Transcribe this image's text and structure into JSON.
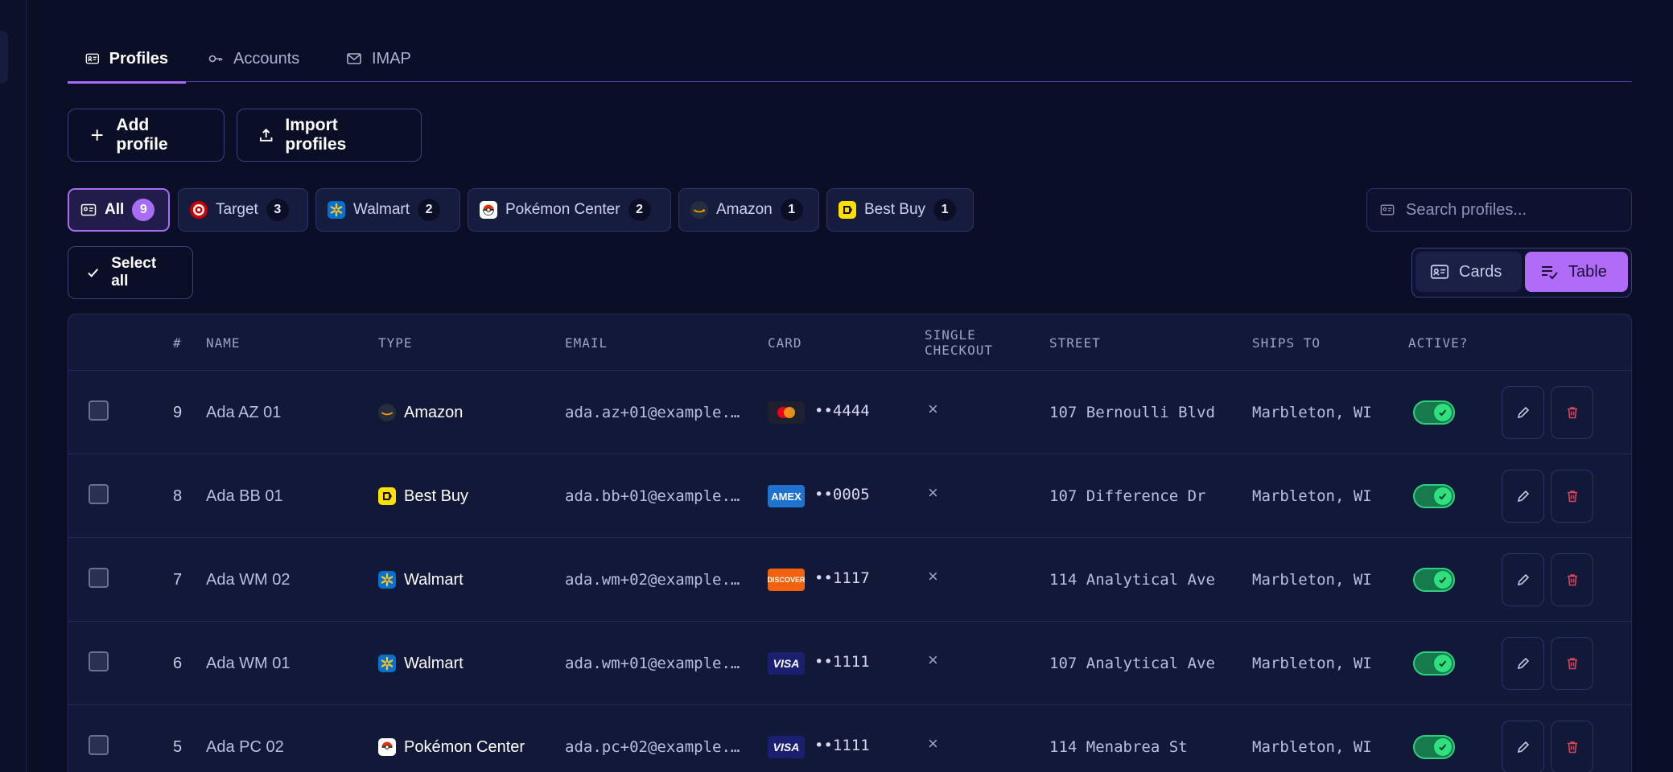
{
  "tabs": [
    {
      "label": "Profiles",
      "icon": "id-card-icon",
      "active": true
    },
    {
      "label": "Accounts",
      "icon": "key-icon",
      "active": false
    },
    {
      "label": "IMAP",
      "icon": "mail-icon",
      "active": false
    }
  ],
  "actions": {
    "add_label": "Add profile",
    "import_label": "Import profiles"
  },
  "filters": [
    {
      "label": "All",
      "count": "9",
      "icon": "id-card-icon"
    },
    {
      "label": "Target",
      "count": "3",
      "icon": "target-logo"
    },
    {
      "label": "Walmart",
      "count": "2",
      "icon": "walmart-logo"
    },
    {
      "label": "Pokémon Center",
      "count": "2",
      "icon": "pokeball-logo"
    },
    {
      "label": "Amazon",
      "count": "1",
      "icon": "amazon-logo"
    },
    {
      "label": "Best Buy",
      "count": "1",
      "icon": "bestbuy-logo"
    }
  ],
  "search": {
    "placeholder": "Search profiles..."
  },
  "select_all_label": "Select all",
  "view": {
    "cards_label": "Cards",
    "table_label": "Table",
    "selected": "Table"
  },
  "table": {
    "headers": {
      "num": "#",
      "name": "NAME",
      "type": "TYPE",
      "email": "EMAIL",
      "card": "CARD",
      "single1": "SINGLE",
      "single2": "CHECKOUT",
      "street": "STREET",
      "ships": "SHIPS TO",
      "active": "ACTIVE?"
    },
    "rows": [
      {
        "num": "9",
        "name": "Ada AZ 01",
        "type": "Amazon",
        "email": "ada.az+01@example.…",
        "card_brand": "mastercard",
        "card_last": "••4444",
        "single_checkout": "×",
        "street": "107 Bernoulli Blvd",
        "ships_to": "Marbleton, WI",
        "active": true
      },
      {
        "num": "8",
        "name": "Ada BB 01",
        "type": "Best Buy",
        "email": "ada.bb+01@example.…",
        "card_brand": "AMEX",
        "card_last": "••0005",
        "single_checkout": "×",
        "street": "107 Difference Dr",
        "ships_to": "Marbleton, WI",
        "active": true
      },
      {
        "num": "7",
        "name": "Ada WM 02",
        "type": "Walmart",
        "email": "ada.wm+02@example.…",
        "card_brand": "DISCOVER",
        "card_last": "••1117",
        "single_checkout": "×",
        "street": "114 Analytical Ave",
        "ships_to": "Marbleton, WI",
        "active": true
      },
      {
        "num": "6",
        "name": "Ada WM 01",
        "type": "Walmart",
        "email": "ada.wm+01@example.…",
        "card_brand": "VISA",
        "card_last": "••1111",
        "single_checkout": "×",
        "street": "107 Analytical Ave",
        "ships_to": "Marbleton, WI",
        "active": true
      },
      {
        "num": "5",
        "name": "Ada PC 02",
        "type": "Pokémon Center",
        "email": "ada.pc+02@example.…",
        "card_brand": "VISA",
        "card_last": "••1111",
        "single_checkout": "×",
        "street": "114 Menabrea St",
        "ships_to": "Marbleton, WI",
        "active": true
      }
    ]
  },
  "colors": {
    "accent": "#a86cf5",
    "background": "#0b0f26",
    "toggle_on": "#2ee07e",
    "delete": "#e0455d"
  }
}
